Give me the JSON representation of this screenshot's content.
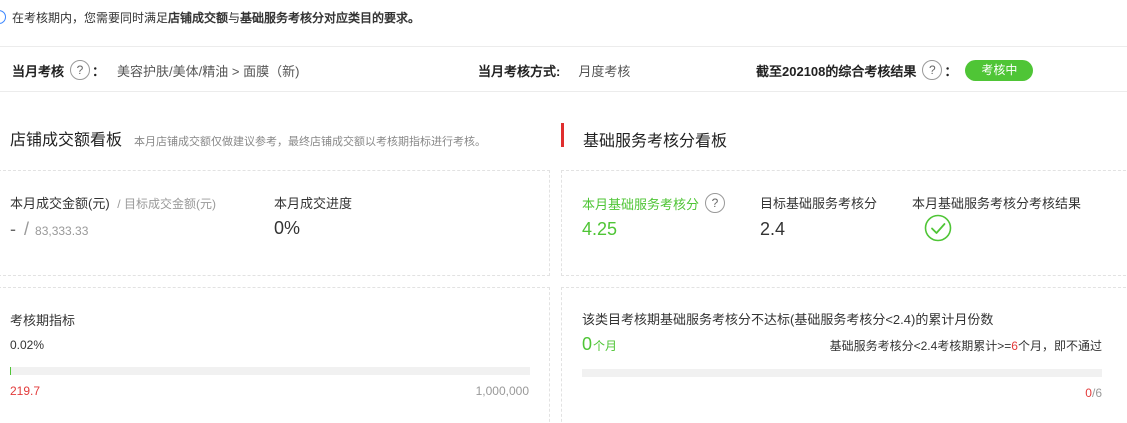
{
  "notice": {
    "prefix": "在考核期内，您需要同时满足",
    "bold1": "店铺成交额",
    "mid": "与",
    "bold2": "基础服务考核分对应类目的要求。"
  },
  "topbar": {
    "current_assessment_label": "当月考核",
    "current_assessment_colon": "：",
    "category_path": "美容护肤/美体/精油 > 面膜（新)",
    "method_label": "当月考核方式:",
    "method_value": "月度考核",
    "result_label": "截至202108的综合考核结果",
    "result_colon": "：",
    "result_badge": "考核中",
    "help_glyph": "?"
  },
  "sales_board": {
    "title": "店铺成交额看板",
    "subtitle": "本月店铺成交额仅做建议参考，最终店铺成交额以考核期指标进行考核。",
    "amount_label": "本月成交金额(元)",
    "target_label": "/ 目标成交金额(元)",
    "amount_value": "-",
    "slash": "/",
    "target_value": "83,333.33",
    "progress_label": "本月成交进度",
    "progress_value": "0%"
  },
  "period_card": {
    "label": "考核期指标",
    "percent_text": "0.02%",
    "progress_fraction": 0.0002,
    "current_value": "219.7",
    "target_value": "1,000,000"
  },
  "service_board": {
    "title": "基础服务考核分看板",
    "score_label": "本月基础服务考核分",
    "score_value": "4.25",
    "target_label": "目标基础服务考核分",
    "target_value": "2.4",
    "result_label": "本月基础服务考核分考核结果",
    "result_icon": "check-circle-icon"
  },
  "fail_card": {
    "title": "该类目考核期基础服务考核分不达标(基础服务考核分<2.4)的累计月份数",
    "count": "0",
    "count_unit": "个月",
    "rule_prefix": "基础服务考核分<2.4考核期累计>=",
    "rule_number": "6",
    "rule_suffix": "个月，即不通过",
    "progress_current": "0",
    "progress_total": "/6",
    "progress_fraction": 0
  },
  "colors": {
    "accent_green": "#4fc536",
    "red": "#e23a3a",
    "section_marker": "#e02e2e"
  }
}
